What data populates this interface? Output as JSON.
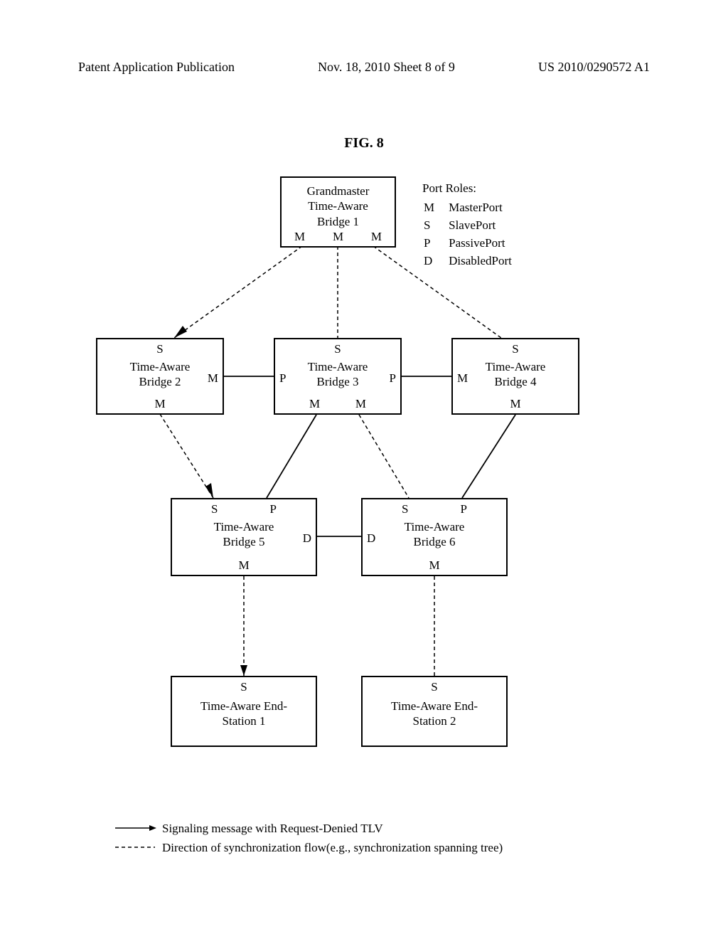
{
  "header": {
    "left": "Patent Application Publication",
    "center": "Nov. 18, 2010  Sheet 8 of 9",
    "right": "US 2010/0290572 A1"
  },
  "figure_title": "FIG. 8",
  "port_roles_title": "Port Roles:",
  "port_roles": [
    {
      "code": "M",
      "name": "MasterPort"
    },
    {
      "code": "S",
      "name": "SlavePort"
    },
    {
      "code": "P",
      "name": "PassivePort"
    },
    {
      "code": "D",
      "name": "DisabledPort"
    }
  ],
  "boxes": {
    "bridge1": {
      "line1": "Grandmaster",
      "line2": "Time-Aware",
      "line3": "Bridge 1"
    },
    "bridge2": {
      "line1": "Time-Aware",
      "line2": "Bridge 2"
    },
    "bridge3": {
      "line1": "Time-Aware",
      "line2": "Bridge 3"
    },
    "bridge4": {
      "line1": "Time-Aware",
      "line2": "Bridge 4"
    },
    "bridge5": {
      "line1": "Time-Aware",
      "line2": "Bridge 5"
    },
    "bridge6": {
      "line1": "Time-Aware",
      "line2": "Bridge 6"
    },
    "station1": {
      "line1": "Time-Aware End-",
      "line2": "Station 1"
    },
    "station2": {
      "line1": "Time-Aware End-",
      "line2": "Station 2"
    }
  },
  "ports": {
    "M": "M",
    "S": "S",
    "P": "P",
    "D": "D"
  },
  "legend": {
    "solid": "Signaling message with Request-Denied TLV",
    "dashed": "Direction of synchronization flow(e.g., synchronization spanning tree)"
  }
}
